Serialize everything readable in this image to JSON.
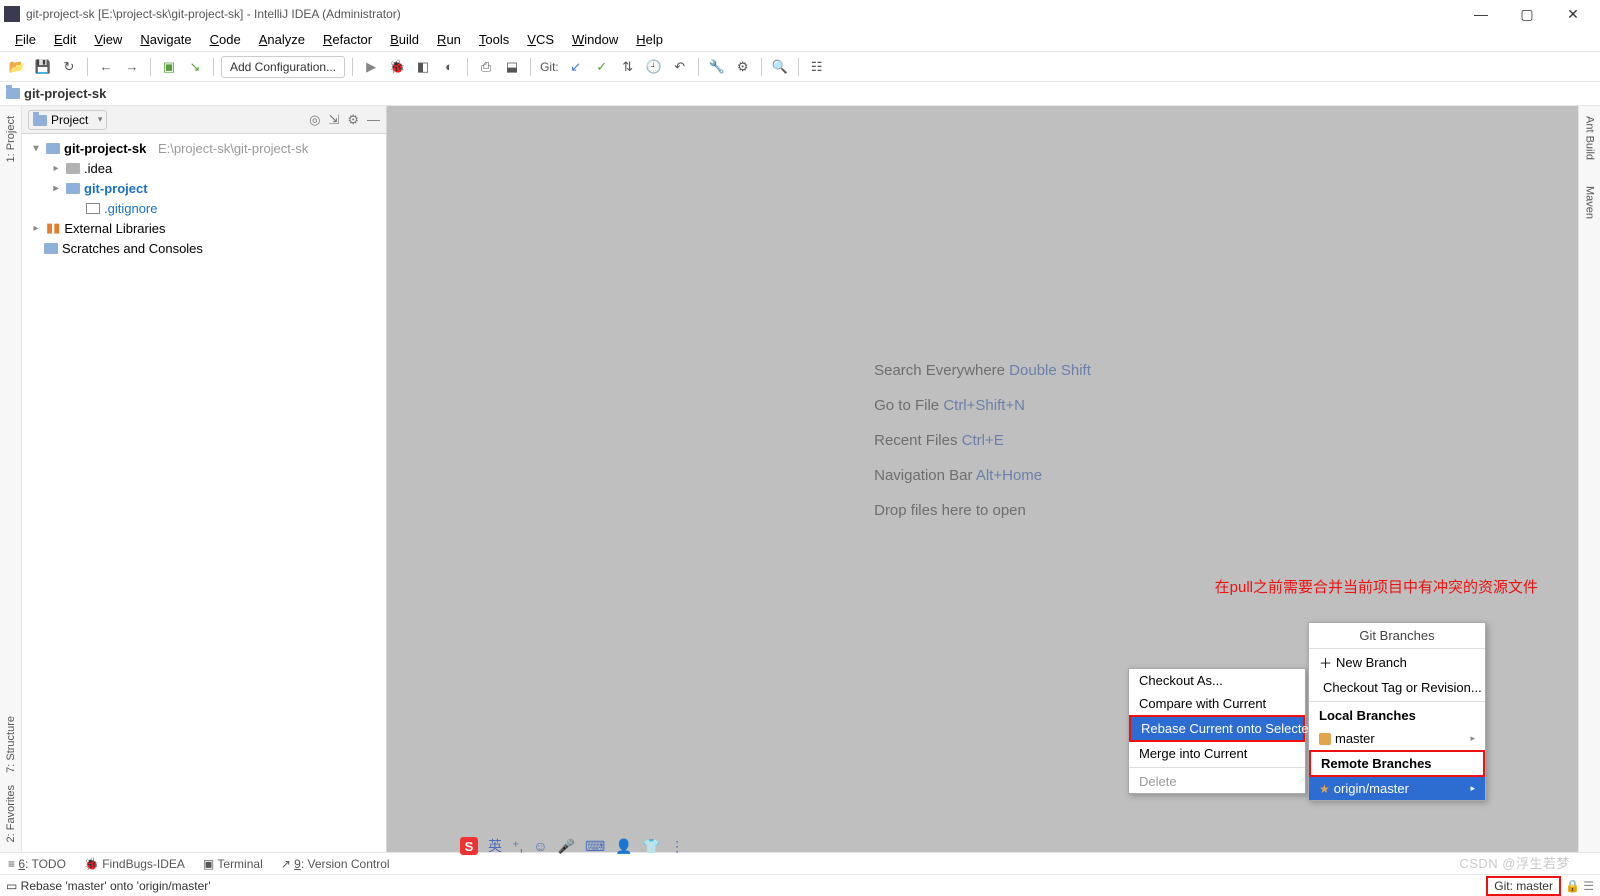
{
  "title": "git-project-sk [E:\\project-sk\\git-project-sk] - IntelliJ IDEA (Administrator)",
  "menubar": [
    "File",
    "Edit",
    "View",
    "Navigate",
    "Code",
    "Analyze",
    "Refactor",
    "Build",
    "Run",
    "Tools",
    "VCS",
    "Window",
    "Help"
  ],
  "run_config": "Add Configuration...",
  "git_label": "Git:",
  "breadcrumb": "git-project-sk",
  "sidebar": {
    "dropdown": "Project",
    "tree": {
      "root": "git-project-sk",
      "root_hint": "E:\\project-sk\\git-project-sk",
      "idea": ".idea",
      "proj": "git-project",
      "ignore": ".gitignore",
      "ext": "External Libraries",
      "scratch": "Scratches and Consoles"
    }
  },
  "left_tabs": {
    "project": "1: Project",
    "structure": "7: Structure",
    "favorites": "2: Favorites"
  },
  "right_tabs": {
    "ant": "Ant Build",
    "maven": "Maven"
  },
  "hints": [
    {
      "t": "Search Everywhere ",
      "s": "Double Shift"
    },
    {
      "t": "Go to File ",
      "s": "Ctrl+Shift+N"
    },
    {
      "t": "Recent Files ",
      "s": "Ctrl+E"
    },
    {
      "t": "Navigation Bar ",
      "s": "Alt+Home"
    },
    {
      "t": "Drop files here to open",
      "s": ""
    }
  ],
  "red_note": "在pull之前需要合并当前项目中有冲突的资源文件",
  "bottom_tabs": {
    "todo": "6: TODO",
    "findbugs": "FindBugs-IDEA",
    "terminal": "Terminal",
    "vc": "9: Version Control"
  },
  "status_text": "Rebase 'master' onto 'origin/master'",
  "status_right": "Git: master",
  "taskbar_label": "英",
  "submenu": {
    "items": [
      "Checkout As...",
      "Compare with Current",
      "Rebase Current onto Selected",
      "Merge into Current",
      "Delete"
    ],
    "selected": 2,
    "disabled": 4
  },
  "branches": {
    "title": "Git Branches",
    "new": "New Branch",
    "checkout": "Checkout Tag or Revision...",
    "local_hdr": "Local Branches",
    "local": "master",
    "remote_hdr": "Remote Branches",
    "remote": "origin/master"
  },
  "watermark": "CSDN @浮生若梦"
}
